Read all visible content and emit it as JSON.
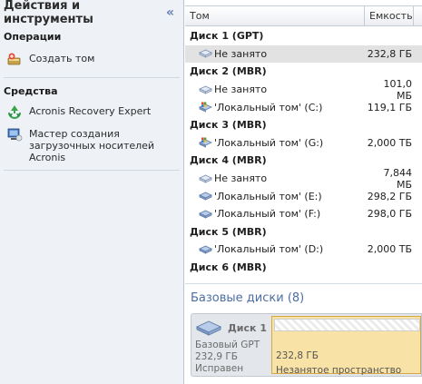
{
  "sidebar": {
    "title": "Действия и инструменты",
    "collapse_glyph": "«",
    "operations": {
      "heading": "Операции",
      "items": [
        {
          "label": "Создать том",
          "icon": "create-volume-icon"
        }
      ]
    },
    "tools": {
      "heading": "Средства",
      "items": [
        {
          "label": "Acronis Recovery Expert",
          "icon": "recovery-expert-icon"
        },
        {
          "label": "Мастер создания загрузочных носителей Acronis",
          "icon": "bootable-media-icon"
        }
      ]
    }
  },
  "table": {
    "columns": {
      "name": "Том",
      "capacity": "Емкость"
    },
    "rows": [
      {
        "kind": "disk",
        "name": "Диск 1 (GPT)"
      },
      {
        "kind": "vol",
        "name": "Не занято",
        "capacity": "232,8 ГБ",
        "icon": "unallocated-icon",
        "selected": true
      },
      {
        "kind": "disk",
        "name": "Диск 2 (MBR)"
      },
      {
        "kind": "vol",
        "name": "Не занято",
        "capacity": "101,0 МБ",
        "icon": "unallocated-icon"
      },
      {
        "kind": "vol",
        "name": "'Локальный том' (C:)",
        "capacity": "119,1 ГБ",
        "icon": "system-volume-icon"
      },
      {
        "kind": "disk",
        "name": "Диск 3 (MBR)"
      },
      {
        "kind": "vol",
        "name": "'Локальный том' (G:)",
        "capacity": "2,000 ТБ",
        "icon": "system-volume-icon"
      },
      {
        "kind": "disk",
        "name": "Диск 4 (MBR)"
      },
      {
        "kind": "vol",
        "name": "Не занято",
        "capacity": "7,844 МБ",
        "icon": "unallocated-icon"
      },
      {
        "kind": "vol",
        "name": "'Локальный том' (E:)",
        "capacity": "298,2 ГБ",
        "icon": "volume-icon"
      },
      {
        "kind": "vol",
        "name": "'Локальный том' (F:)",
        "capacity": "298,0 ГБ",
        "icon": "volume-icon"
      },
      {
        "kind": "disk",
        "name": "Диск 5 (MBR)"
      },
      {
        "kind": "vol",
        "name": "'Локальный том' (D:)",
        "capacity": "2,000 ТБ",
        "icon": "volume-icon"
      },
      {
        "kind": "disk",
        "name": "Диск 6 (MBR)"
      }
    ]
  },
  "basic_disks": {
    "title": "Базовые диски (8)",
    "disk": {
      "name": "Диск 1",
      "type": "Базовый GPT",
      "size": "232,9 ГБ",
      "status": "Исправен",
      "partition": {
        "size": "232,8 ГБ",
        "label": "Незанятое пространство"
      }
    }
  },
  "colors": {
    "sidebar_bg": "#eef1f6",
    "accent_blue": "#4d6ea3",
    "partition_yellow": "#f8e2a5",
    "selection_gray": "#e2e2e2"
  }
}
